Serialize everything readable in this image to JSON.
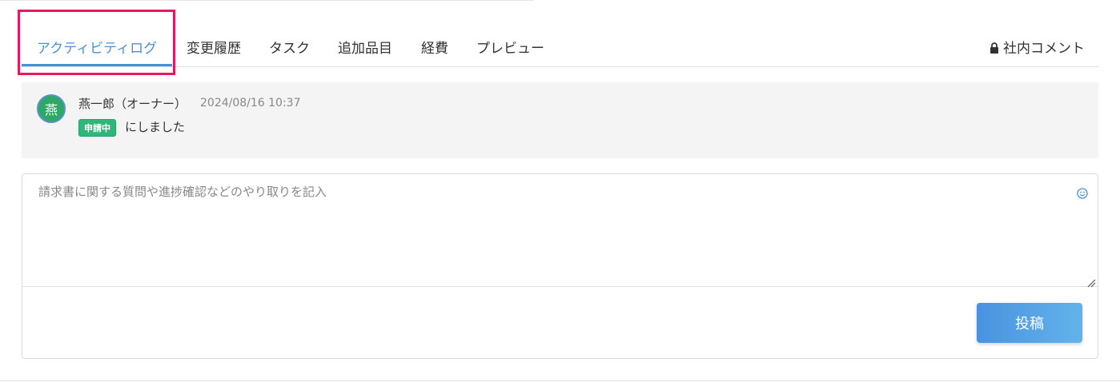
{
  "tabs": {
    "items": [
      {
        "label": "アクティビティログ",
        "active": true
      },
      {
        "label": "変更履歴",
        "active": false
      },
      {
        "label": "タスク",
        "active": false
      },
      {
        "label": "追加品目",
        "active": false
      },
      {
        "label": "経費",
        "active": false
      },
      {
        "label": "プレビュー",
        "active": false
      }
    ],
    "internal_comment_label": "社内コメント",
    "internal_comment_icon": "lock-icon"
  },
  "activity": {
    "avatar_text": "燕",
    "author": "燕一郎（オーナー）",
    "timestamp": "2024/08/16 10:37",
    "status_badge": "申請中",
    "text": "にしました"
  },
  "comment": {
    "placeholder": "請求書に関する質問や進捗確認などのやり取りを記入",
    "value": "",
    "emoji_icon": "smiley-icon",
    "post_label": "投稿"
  },
  "colors": {
    "accent": "#4a90d9",
    "highlight": "#e8185f",
    "status_green": "#2db87a",
    "avatar_green": "#2ea866",
    "post_button": "#4a92e0"
  }
}
